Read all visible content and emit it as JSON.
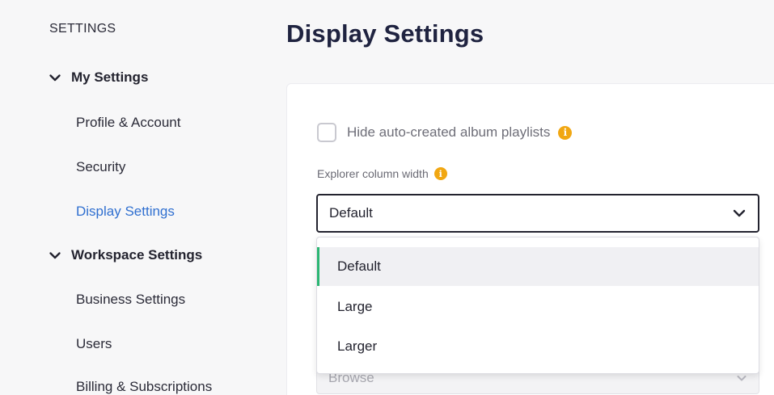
{
  "sidebar": {
    "header": "SETTINGS",
    "my_settings": {
      "label": "My Settings",
      "items": [
        {
          "label": "Profile & Account"
        },
        {
          "label": "Security"
        },
        {
          "label": "Display Settings"
        }
      ]
    },
    "workspace_settings": {
      "label": "Workspace Settings",
      "items": [
        {
          "label": "Business Settings"
        },
        {
          "label": "Users"
        },
        {
          "label": "Billing & Subscriptions"
        }
      ]
    }
  },
  "main": {
    "title": "Display Settings",
    "hide_playlists": {
      "label": "Hide auto-created album playlists",
      "checked": false
    },
    "column_width": {
      "label": "Explorer column width",
      "value": "Default",
      "options": [
        "Default",
        "Large",
        "Larger"
      ],
      "selected_index": 0
    },
    "browse_field": {
      "value": "Browse"
    }
  },
  "colors": {
    "accent_link": "#2f6fd0",
    "selected_marker": "#2bb673",
    "info_icon": "#f1a712",
    "title": "#1f2340"
  },
  "icons": {
    "info": "i"
  }
}
